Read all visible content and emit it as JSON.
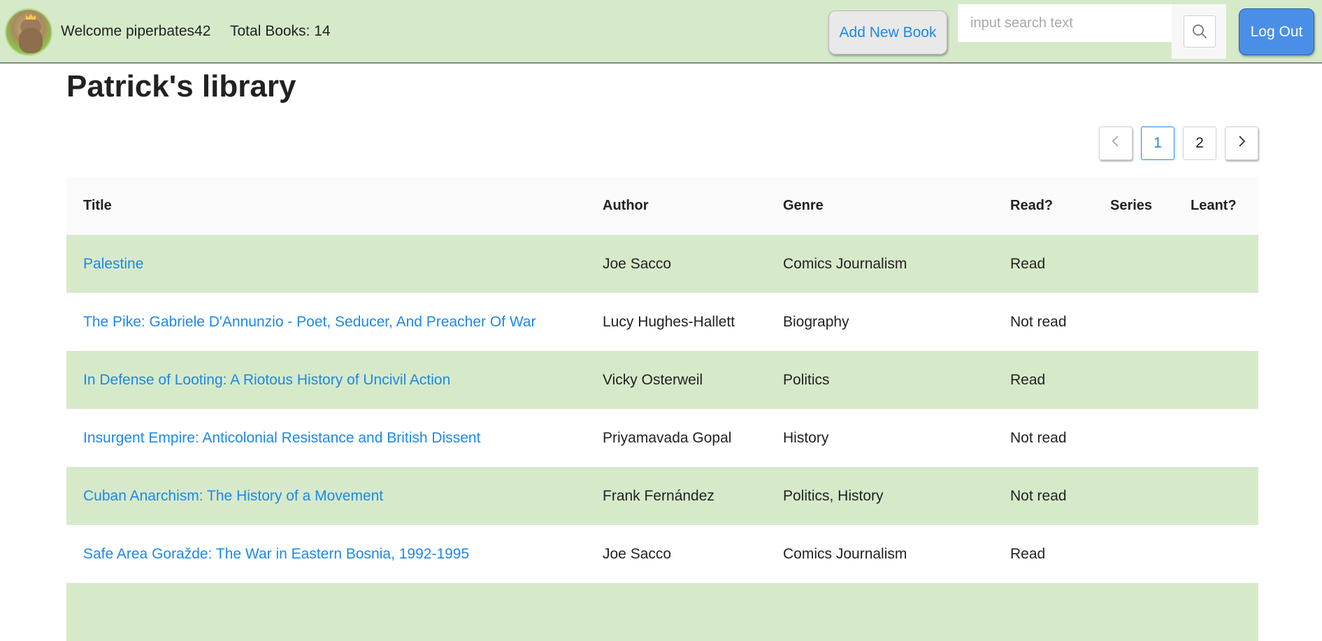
{
  "header": {
    "avatar_alt": "bear avatar",
    "welcome_text": "Welcome piperbates42",
    "total_books_text": "Total Books: 14",
    "add_book_label": "Add New Book",
    "search": {
      "placeholder": "input search text",
      "value": ""
    },
    "logout_label": "Log Out",
    "colors": {
      "header_bg": "#d6eaca",
      "accent": "#1e88e5",
      "logout_bg": "#4a8fe7"
    }
  },
  "page_title": "Patrick's library",
  "pagination": {
    "prev_label": "<",
    "pages": [
      "1",
      "2"
    ],
    "current_page": "1",
    "next_label": ">"
  },
  "table": {
    "columns": [
      "Title",
      "Author",
      "Genre",
      "Read?",
      "Series",
      "Leant?"
    ],
    "rows": [
      {
        "title": "Palestine",
        "author": "Joe Sacco",
        "genre": "Comics Journalism",
        "read": "Read",
        "series": "",
        "leant": ""
      },
      {
        "title": "The Pike: Gabriele D'Annunzio - Poet, Seducer, And Preacher Of War",
        "author": "Lucy Hughes-Hallett",
        "genre": "Biography",
        "read": "Not read",
        "series": "",
        "leant": ""
      },
      {
        "title": "In Defense of Looting: A Riotous History of Uncivil Action",
        "author": "Vicky Osterweil",
        "genre": "Politics",
        "read": "Read",
        "series": "",
        "leant": ""
      },
      {
        "title": "Insurgent Empire: Anticolonial Resistance and British Dissent",
        "author": "Priyamavada Gopal",
        "genre": "History",
        "read": "Not read",
        "series": "",
        "leant": ""
      },
      {
        "title": "Cuban Anarchism: The History of a Movement",
        "author": "Frank Fernández",
        "genre": "Politics, History",
        "read": "Not read",
        "series": "",
        "leant": ""
      },
      {
        "title": "Safe Area Goražde: The War in Eastern Bosnia, 1992-1995",
        "author": "Joe Sacco",
        "genre": "Comics Journalism",
        "read": "Read",
        "series": "",
        "leant": ""
      },
      {
        "title": "",
        "author": "",
        "genre": "",
        "read": "",
        "series": "",
        "leant": ""
      }
    ]
  }
}
